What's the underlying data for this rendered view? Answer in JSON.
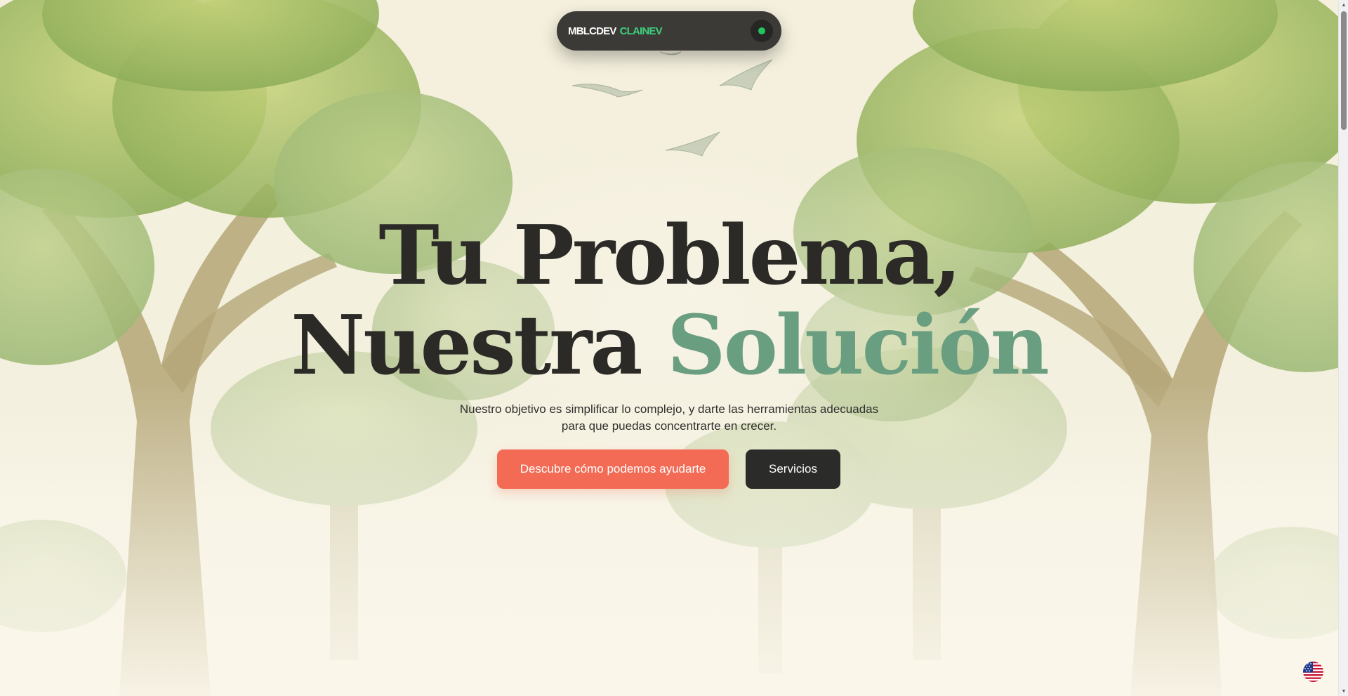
{
  "navbar": {
    "brand_primary": "MBLCDEV",
    "brand_secondary": "CLAINEV",
    "brand_secondary_color": "#3ecf7d",
    "status_color": "#22c55e"
  },
  "hero": {
    "headline_line1": "Tu Problema,",
    "headline_line2_dark": "Nuestra",
    "headline_line2_accent": "Solución",
    "accent_color": "#6a9e80",
    "subtitle": "Nuestro objetivo es simplificar lo complejo, y darte las herramientas adecuadas para que puedas concentrarte en crecer.",
    "primary_cta": "Descubre cómo podemos ayudarte",
    "primary_cta_color": "#f36b55",
    "secondary_cta": "Servicios",
    "secondary_cta_color": "#2b2b29"
  },
  "language": {
    "icon": "us-flag-icon"
  },
  "background": {
    "icon_trees": "trees-illustration",
    "icon_birds": "bird-icon"
  }
}
